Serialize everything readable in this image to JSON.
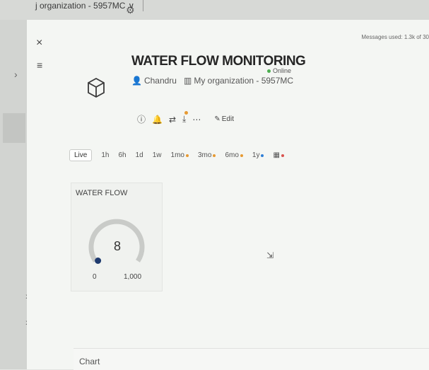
{
  "header": {
    "org_label": "j organization - 5957MC",
    "chevron": "∨"
  },
  "left_rail": {
    "chevron_top": "›",
    "chevron_mid": "›",
    "chevron_bottom": "›"
  },
  "usage": {
    "messages_text": "Messages used: 1.3k of 30"
  },
  "device": {
    "title": "WATER FLOW MONITORING",
    "status": "Online",
    "owner": "Chandru",
    "organization": "My organization - 5957MC"
  },
  "actions": {
    "edit_label": "Edit"
  },
  "time_ranges": {
    "live": "Live",
    "h1": "1h",
    "h6": "6h",
    "d1": "1d",
    "w1": "1w",
    "mo1": "1mo",
    "mo3": "3mo",
    "mo6": "6mo",
    "y1": "1y"
  },
  "widget": {
    "title": "WATER FLOW",
    "value": "8",
    "min_label": "0",
    "max_label": "1,000",
    "fraction": 0.008
  },
  "sections": {
    "chart_label": "Chart"
  },
  "colors": {
    "online": "#4caf50",
    "badge_orange": "#e69a33",
    "badge_blue": "#2f7fd6",
    "badge_red": "#d9534f",
    "gauge_track": "#c9cbc8",
    "gauge_fill": "#1e3a6e"
  },
  "icons": [
    "close-icon",
    "menu-icon",
    "cube-icon",
    "user-icon",
    "building-icon",
    "info-icon",
    "bell-icon",
    "share-icon",
    "download-icon",
    "more-icon",
    "edit-icon",
    "gear-icon",
    "chevron-right-icon",
    "cursor-icon"
  ]
}
